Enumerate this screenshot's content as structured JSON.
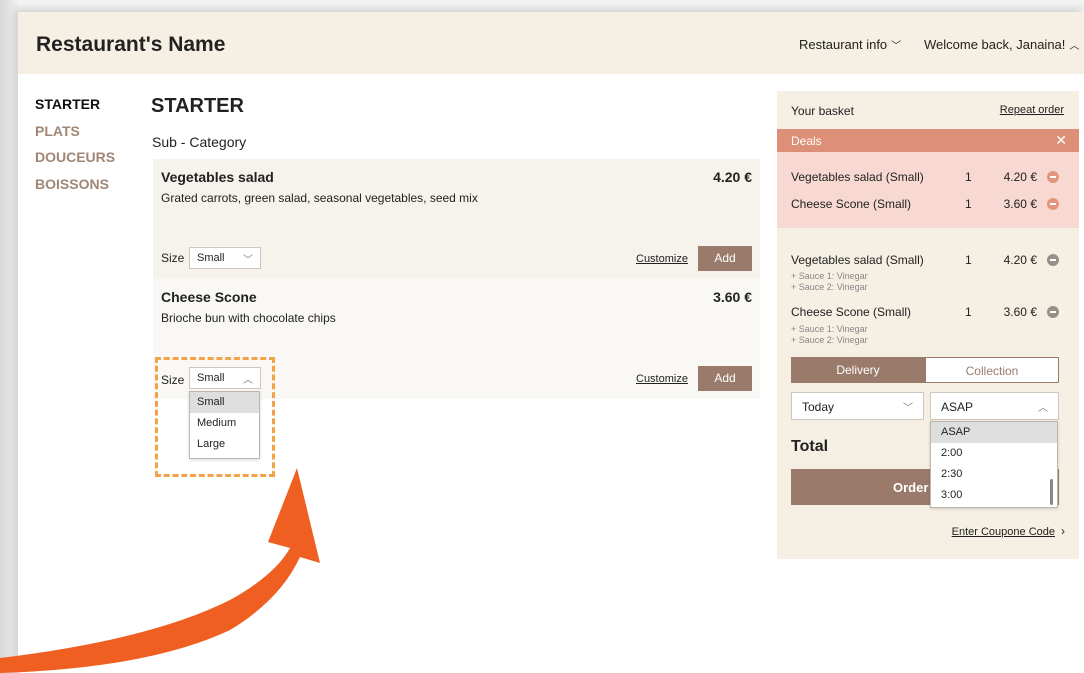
{
  "header": {
    "brand": "Restaurant's Name",
    "restaurant_info": "Restaurant info",
    "welcome": "Welcome back, Janaina!"
  },
  "sidebar": {
    "items": [
      {
        "label": "STARTER",
        "active": true
      },
      {
        "label": "PLATS",
        "active": false
      },
      {
        "label": "DOUCEURS",
        "active": false
      },
      {
        "label": "BOISSONS",
        "active": false
      }
    ]
  },
  "main": {
    "section_title": "STARTER",
    "sub_category": "Sub - Category",
    "items": [
      {
        "name": "Vegetables salad",
        "description": "Grated carrots, green salad, seasonal vegetables, seed mix",
        "price": "4.20 €",
        "size_label": "Size",
        "size_value": "Small",
        "customize": "Customize",
        "add": "Add"
      },
      {
        "name": "Cheese Scone",
        "description": "Brioche bun with chocolate chips",
        "price": "3.60 €",
        "size_label": "Size",
        "size_value": "Small",
        "customize": "Customize",
        "add": "Add",
        "size_options": [
          "Small",
          "Medium",
          "Large"
        ]
      }
    ]
  },
  "basket": {
    "title": "Your basket",
    "repeat_order": "Repeat order",
    "deals_label": "Deals",
    "deals_close": "✕",
    "deal_lines": [
      {
        "name": "Vegetables salad (Small)",
        "qty": "1",
        "price": "4.20 €"
      },
      {
        "name": "Cheese Scone (Small)",
        "qty": "1",
        "price": "3.60 €"
      }
    ],
    "lines": [
      {
        "name": "Vegetables salad (Small)",
        "qty": "1",
        "price": "4.20 €",
        "sub": [
          "+ Sauce 1: Vinegar",
          "+ Sauce 2: Vinegar"
        ]
      },
      {
        "name": "Cheese Scone (Small)",
        "qty": "1",
        "price": "3.60 €",
        "sub": [
          "+ Sauce 1: Vinegar",
          "+ Sauce 2: Vinegar"
        ]
      }
    ],
    "tab_delivery": "Delivery",
    "tab_collection": "Collection",
    "day_value": "Today",
    "time_value": "ASAP",
    "time_options": [
      "ASAP",
      "2:00",
      "2:30",
      "3:00"
    ],
    "total_label": "Total",
    "order_label": "Order",
    "coupon": "Enter Coupone Code"
  },
  "colors": {
    "header_bg": "#f6efe3",
    "accent_brown": "#9a7a6a",
    "deals_red": "#dd8f77",
    "deals_bg": "#f8d9d2",
    "highlight_orange": "#f4a24a",
    "arrow_orange": "#ef5f22"
  },
  "icons": {
    "chevron_down": "chevron-down-icon",
    "chevron_up": "chevron-up-icon",
    "remove": "minus-circle-icon",
    "close": "close-icon",
    "chevron_right": "chevron-right-icon"
  }
}
